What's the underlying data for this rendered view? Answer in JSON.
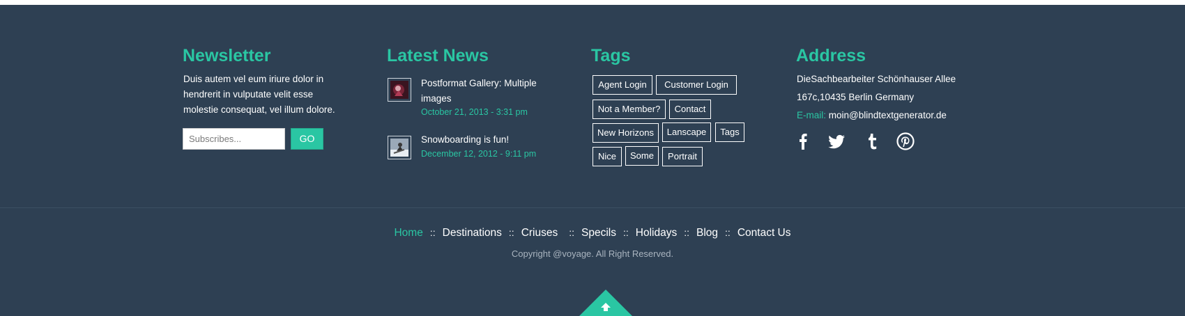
{
  "newsletter": {
    "title": "Newsletter",
    "text": "Duis autem vel eum iriure dolor in hendrerit in vulputate velit esse molestie consequat, vel illum dolore.",
    "input_placeholder": "Subscribes...",
    "button_label": "GO"
  },
  "latest_news": {
    "title": "Latest News",
    "items": [
      {
        "title": "Postformat Gallery: Multiple images",
        "date": "October 21, 2013 - 3:31 pm",
        "thumb_icon": "gallery-photo-icon"
      },
      {
        "title": "Snowboarding is fun!",
        "date": "December 12, 2012 - 9:11 pm",
        "thumb_icon": "snowboard-photo-icon"
      }
    ]
  },
  "tags": {
    "title": "Tags",
    "items": [
      "Agent Login",
      "Customer Login",
      "Not a Member?",
      "Contact",
      "New Horizons",
      "Lanscape",
      "Tags",
      "Nice",
      "Some",
      "Portrait"
    ]
  },
  "address": {
    "title": "Address",
    "line1": "DieSachbearbeiter Schönhauser Allee",
    "line2": "167c,10435 Berlin Germany",
    "email_label": "E-mail:",
    "email": "moin@blindtextgenerator.de",
    "social_icons": [
      "facebook-icon",
      "twitter-icon",
      "tumblr-icon",
      "pinterest-icon"
    ]
  },
  "footer_nav": {
    "separator": "::",
    "items": [
      {
        "label": "Home",
        "active": true
      },
      {
        "label": "Destinations"
      },
      {
        "label": "Criuses"
      },
      {
        "label": "Specils"
      },
      {
        "label": "Holidays"
      },
      {
        "label": "Blog"
      },
      {
        "label": "Contact Us"
      }
    ]
  },
  "copyright": "Copyright @voyage. All Right Reserved.",
  "colors": {
    "background": "#2e4053",
    "accent": "#2ac6a3",
    "text": "#ffffff",
    "muted": "#a9b4bf"
  }
}
